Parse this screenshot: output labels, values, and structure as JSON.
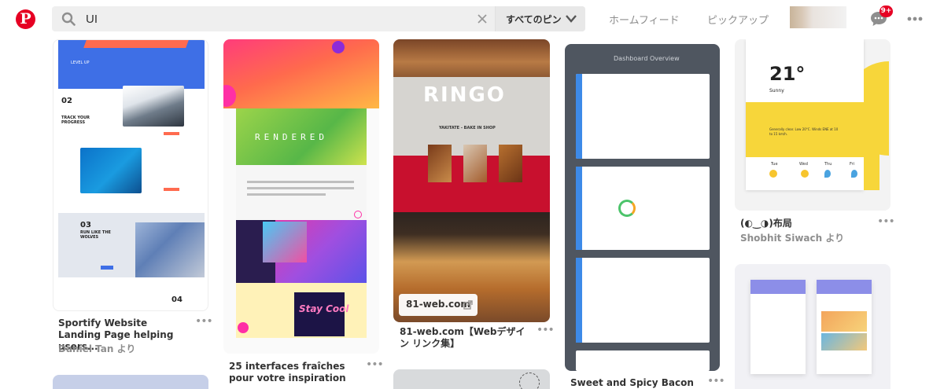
{
  "header": {
    "logo_letter": "P",
    "search": {
      "value": "UI",
      "placeholder": ""
    },
    "scope_label": "すべてのピン",
    "nav": {
      "home": "ホームフィード",
      "pickup": "ピックアップ"
    },
    "notifications_badge": "9+",
    "colors": {
      "brand": "#e60023"
    }
  },
  "pins": [
    {
      "title": "Sportify Website Landing Page helping users...",
      "by": "Daniel Tan より",
      "image_text": {
        "step2": "02",
        "step2_title": "TRACK YOUR PROGRESS",
        "step3": "03",
        "step3_title": "RUN LIKE THE WOLVES",
        "step4": "04"
      }
    },
    {
      "title": "25 interfaces fraîches pour votre inspiration",
      "image_text": {
        "brand": "RENDERED",
        "script": "Stay Cool"
      }
    },
    {
      "title": "81-web.com【Webデザイン リンク集】",
      "link_chip": "81-web.com",
      "image_text": {
        "brand": "RINGO",
        "tagline": "YAKITATE - BAKE IN SHOP"
      }
    },
    {
      "title": "Sweet and Spicy Bacon",
      "image_text": {
        "heading": "Dashboard Overview"
      }
    },
    {
      "title": "(◐‿◑)布局",
      "by": "Shobhit Siwach より",
      "image_text": {
        "temp": "21°",
        "cond": "Sunny",
        "forecast": "Generally clear. Low 20°C. Winds ENE at 10 to 15 km/h.",
        "days": [
          "Tue",
          "Wed",
          "Thu",
          "Fri"
        ]
      }
    }
  ]
}
